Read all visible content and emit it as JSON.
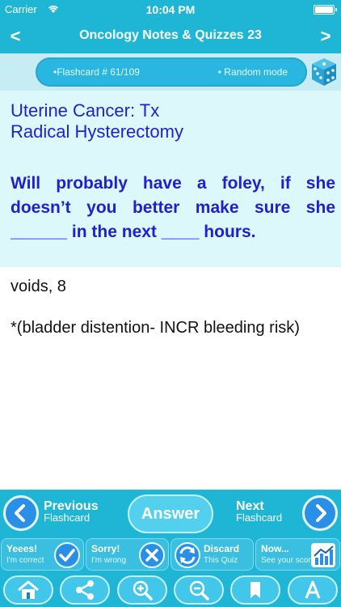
{
  "status_bar": {
    "carrier": "Carrier",
    "time": "10:04 PM"
  },
  "nav": {
    "title": "Oncology Notes & Quizzes 23",
    "back_icon": "chevron-left-icon",
    "forward_icon": "chevron-right-icon"
  },
  "info": {
    "flashcard": "•Flashcard # 61/109",
    "mode": "• Random mode",
    "dice_icon": "dice-icon"
  },
  "question": {
    "title_line1": "Uterine Cancer: Tx",
    "title_line2": "Radical Hysterectomy",
    "body": "Will probably have a foley, if she doesn’t you better make sure she ______ in the next ____ hours."
  },
  "answer": {
    "line1": "voids, 8",
    "line2": "*(bladder distention- INCR bleeding risk)"
  },
  "controls": {
    "previous_big": "Previous",
    "previous_small": "Flashcard",
    "answer": "Answer",
    "next_big": "Next",
    "next_small": "Flashcard"
  },
  "segments": [
    {
      "title": "Yeees!",
      "sub": "I'm correct",
      "icon": "check-icon"
    },
    {
      "title": "Sorry!",
      "sub": "I'm wrong",
      "icon": "x-icon"
    },
    {
      "title": "Discard",
      "sub": "This Quiz",
      "icon": "recycle-icon"
    },
    {
      "title": "Now...",
      "sub": "See your score",
      "icon": "chart-icon"
    }
  ],
  "toolbar": [
    "home-icon",
    "share-icon",
    "zoom-in-icon",
    "zoom-out-icon",
    "bookmark-icon",
    "font-icon"
  ],
  "colors": {
    "primary": "#1fb6d6",
    "question_text": "#1f1fd0",
    "question_bg": "#ddf8fb"
  }
}
